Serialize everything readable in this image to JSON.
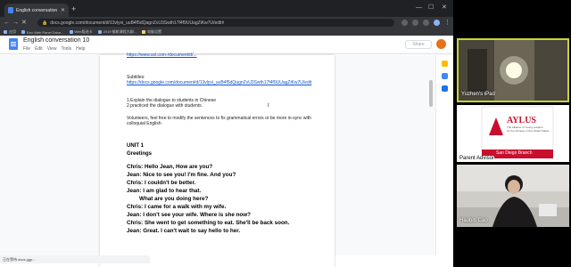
{
  "browser": {
    "tab_title": "English conversation 10 - Go...",
    "new_tab": "+",
    "url": "docs.google.com/document/d/13vlyvi_uuB4f5dQagnZvU3Swth17f4f9UUagZiKw7U/edit#",
    "bookmarks": [
      {
        "label": "应用"
      },
      {
        "label": "Eeo Web Panel Drive..."
      },
      {
        "label": "Web版选卡"
      },
      {
        "label": "2019 佛航课程大纲..."
      },
      {
        "label": "电脑设置"
      }
    ],
    "status_bar": "正在等待 docs.ggp..."
  },
  "doc": {
    "title": "English conversation 10",
    "menus": [
      "File",
      "Edit",
      "View",
      "Tools",
      "Help"
    ],
    "share_label": "Share",
    "content": {
      "top_link": "https://www.ssl.com-/document/d/...",
      "subtitles_label": "Subtitles:",
      "subtitles_link": "https://docs.google.com/document/d/13vlyvi_uuB4f5dQagnZvU3Swth17f4f9UUagZiKw7U/edit",
      "instruction_1": "1.Explain the dialogue to students in Chinese",
      "instruction_2": "2.practiced the dialogue with students.",
      "volunteer_note_1": "Volunteers, feel free to modify the sentences to fix grammatical errors or be more in-sync with",
      "volunteer_note_2": "colloquial English",
      "cursor_char": "I",
      "unit_heading": "UNIT 1",
      "unit_subheading": "Greetings",
      "dialogue": [
        "Chris: Hello Jean, How are you?",
        "Jean: Nice to see you! I'm fine. And you?",
        "Chris: I couldn't be better.",
        "Jean: I am glad to hear that.",
        "        What are you doing here?",
        "Chris: I came for a walk with my wife.",
        "Jean: I don't see your wife. Where is she now?",
        "Chris: She went to get something to eat. She'll be back soon.",
        "Jean: Great. I can't wait to say hello to her."
      ]
    }
  },
  "video": {
    "tiles": [
      {
        "name": "Yuzhen's iPad",
        "active_color": "#c9d33a"
      },
      {
        "name": "Parent Advisor",
        "logo_text": "AYLUS",
        "logo_caption": "The Alliance of Young Leaders\nfor the Chinese in the United States",
        "branch": "San Diego Branch"
      },
      {
        "name": "Haobin Cao"
      }
    ]
  },
  "colors": {
    "docs_blue": "#4285f4",
    "chrome_dark": "#202124",
    "chrome_toolbar": "#35363a",
    "aylus_red": "#c8102e",
    "link": "#1155cc"
  }
}
